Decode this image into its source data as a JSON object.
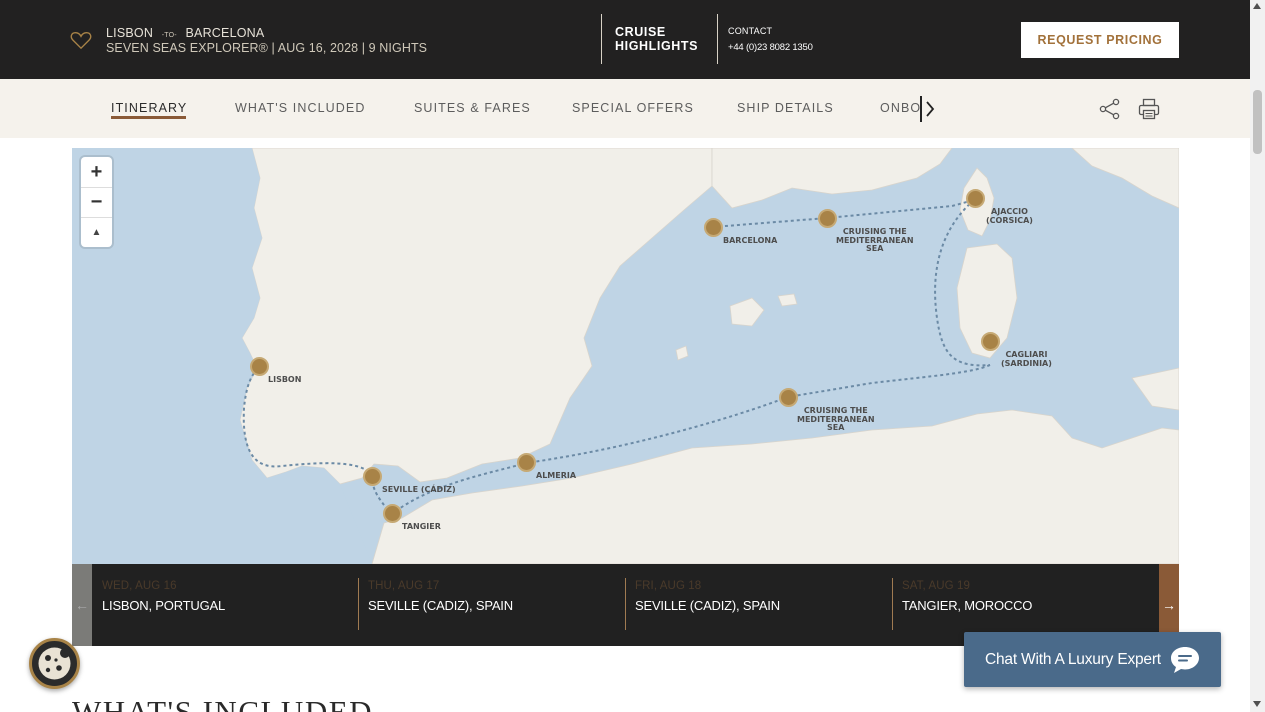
{
  "header": {
    "origin": "LISBON",
    "to_word": "-TO-",
    "destination": "BARCELONA",
    "ship_line": "SEVEN SEAS EXPLORER®  |  AUG 16, 2028  |  9 NIGHTS",
    "highlights_line1": "CRUISE",
    "highlights_line2": "HIGHLIGHTS",
    "contact_label": "CONTACT",
    "contact_phone": "+44 (0)23 8082 1350",
    "request_button": "REQUEST PRICING",
    "colors": {
      "background": "#222121",
      "accent": "#a2713a"
    }
  },
  "nav": {
    "tabs": [
      {
        "label": "ITINERARY",
        "active": true
      },
      {
        "label": "WHAT'S INCLUDED",
        "active": false
      },
      {
        "label": "SUITES & FARES",
        "active": false
      },
      {
        "label": "SPECIAL OFFERS",
        "active": false
      },
      {
        "label": "SHIP DETAILS",
        "active": false
      },
      {
        "label": "ONBOARD",
        "active": false
      }
    ],
    "truncated_tab": "ONBOARD",
    "icons": [
      "chevron-right-icon",
      "share-icon",
      "print-icon"
    ]
  },
  "map": {
    "zoom_in": "+",
    "zoom_out": "−",
    "reset_north": "▲",
    "ports": {
      "barcelona": "BARCELONA",
      "cruising1_line1": "CRUISING THE",
      "cruising1_line2": "MEDITERRANEAN",
      "cruising1_line3": "SEA",
      "ajaccio_line1": "AJACCIO",
      "ajaccio_line2": "(CORSICA)",
      "cagliari_line1": "CAGLIARI",
      "cagliari_line2": "(SARDINIA)",
      "cruising2_line1": "CRUISING THE",
      "cruising2_line2": "MEDITERRANEAN",
      "cruising2_line3": "SEA",
      "lisbon": "LISBON",
      "seville": "SEVILLE (CÁDIZ)",
      "almeria": "ALMERIA",
      "tangier": "TANGIER"
    },
    "colors": {
      "sea": "#bfd4e5",
      "land": "#f1efe9",
      "route": "#6b8aa5",
      "dot": "#a88347"
    }
  },
  "itinerary": {
    "prev_arrow": "←",
    "next_arrow": "→",
    "days": [
      {
        "date": "WED, AUG 16",
        "place": "LISBON, PORTUGAL"
      },
      {
        "date": "THU, AUG 17",
        "place": "SEVILLE (CADIZ), SPAIN"
      },
      {
        "date": "FRI, AUG 18",
        "place": "SEVILLE (CADIZ), SPAIN"
      },
      {
        "date": "SAT, AUG 19",
        "place": "TANGIER, MOROCCO"
      }
    ]
  },
  "section": {
    "title": "WHAT'S INCLUDED"
  },
  "chat": {
    "label": "Chat With A Luxury Expert",
    "icon": "chat-bubble-icon"
  },
  "cookie": {
    "icon": "cookie-icon"
  }
}
